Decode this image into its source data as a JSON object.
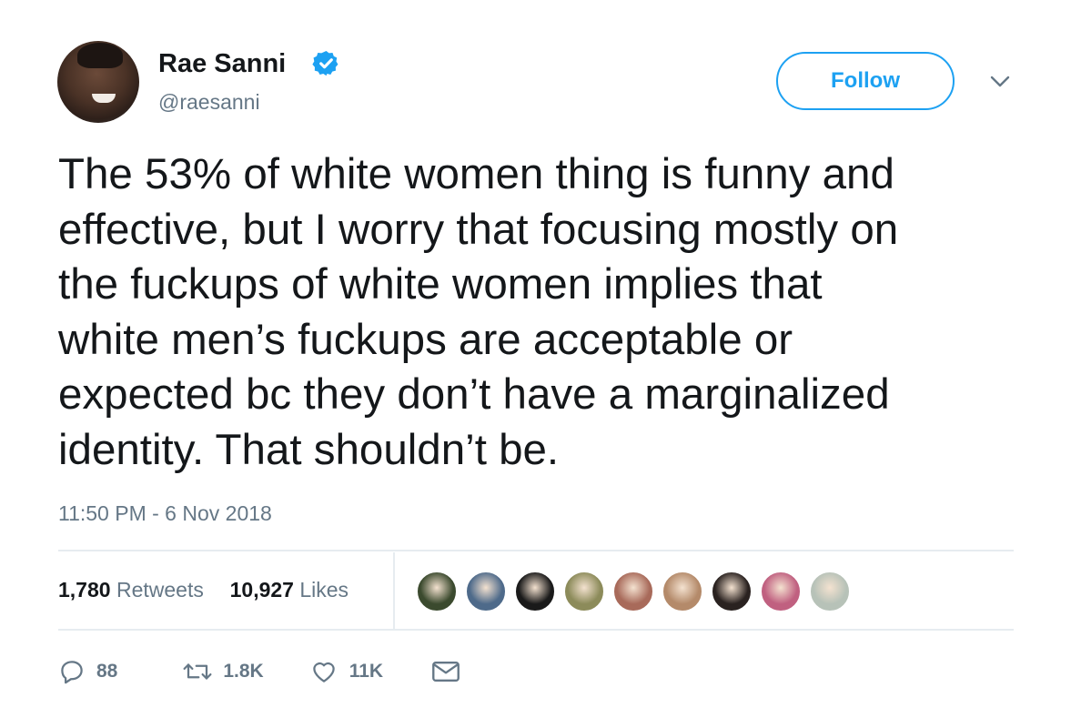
{
  "author": {
    "name": "Rae Sanni",
    "handle": "@raesanni",
    "verified": true
  },
  "follow_label": "Follow",
  "tweet": {
    "lines": [
      "The 53% of white women thing is funny and",
      "effective, but I worry that focusing mostly on",
      "the fuckups of white women implies that",
      "white men’s fuckups are acceptable or",
      "expected bc they don’t have a marginalized",
      "identity. That shouldn’t be."
    ],
    "timestamp": "11:50 PM - 6 Nov 2018"
  },
  "stats": {
    "retweets_count": "1,780",
    "retweets_label": "Retweets",
    "likes_count": "10,927",
    "likes_label": "Likes"
  },
  "actions": {
    "replies": "88",
    "retweets": "1.8K",
    "likes": "11K"
  },
  "colors": {
    "accent": "#1da1f2",
    "secondary_text": "#657786",
    "divider": "#e6ecf0"
  },
  "liker_faces": [
    {
      "color": "#3b4a2e"
    },
    {
      "color": "#4e6a8a"
    },
    {
      "color": "#1a1a1a"
    },
    {
      "color": "#8c8b5a"
    },
    {
      "color": "#a86a5a"
    },
    {
      "color": "#b48a6a"
    },
    {
      "color": "#2a2220"
    },
    {
      "color": "#c06080"
    },
    {
      "color": "#b7c2b8"
    }
  ]
}
